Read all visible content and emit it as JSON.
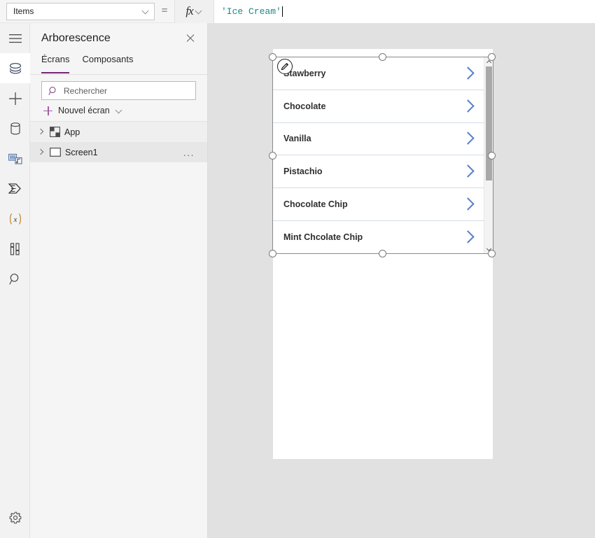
{
  "formula_bar": {
    "property": "Items",
    "equals": "=",
    "fx_label": "fx",
    "formula": "'Ice Cream'"
  },
  "rail": {
    "items": [
      {
        "name": "hamburger-menu-icon",
        "label": "Menu"
      },
      {
        "name": "layers-icon",
        "label": "Arborescence",
        "selected": true
      },
      {
        "name": "plus-icon",
        "label": "Insérer"
      },
      {
        "name": "database-icon",
        "label": "Données"
      },
      {
        "name": "media-icon",
        "label": "Médias"
      },
      {
        "name": "power-automate-icon",
        "label": "Power Automate"
      },
      {
        "name": "variables-icon",
        "label": "(x)"
      },
      {
        "name": "tools-icon",
        "label": "Tests"
      },
      {
        "name": "search-icon",
        "label": "Recherche"
      }
    ],
    "settings_label": "Paramètres"
  },
  "tree_panel": {
    "title": "Arborescence",
    "close_label": "Fermer",
    "tabs": [
      {
        "label": "Écrans",
        "active": true
      },
      {
        "label": "Composants",
        "active": false
      }
    ],
    "search_placeholder": "Rechercher",
    "new_screen_label": "Nouvel écran",
    "rows": [
      {
        "label": "App",
        "icon": "app-grid-icon",
        "has_menu": false
      },
      {
        "label": "Screen1",
        "icon": "screen-rect-icon",
        "has_menu": true,
        "menu_label": "..."
      }
    ]
  },
  "canvas": {
    "gallery": {
      "items": [
        {
          "label": "Stawberry"
        },
        {
          "label": "Chocolate"
        },
        {
          "label": "Vanilla"
        },
        {
          "label": "Pistachio"
        },
        {
          "label": "Chocolate Chip"
        },
        {
          "label": "Mint Chcolate Chip"
        }
      ]
    }
  },
  "colors": {
    "accent_purple": "#742774",
    "chevron_blue": "#5b7fc7",
    "formula_text": "#1a8a86",
    "separator": "#d4dce8",
    "canvas_bg": "#e1e1e1"
  }
}
